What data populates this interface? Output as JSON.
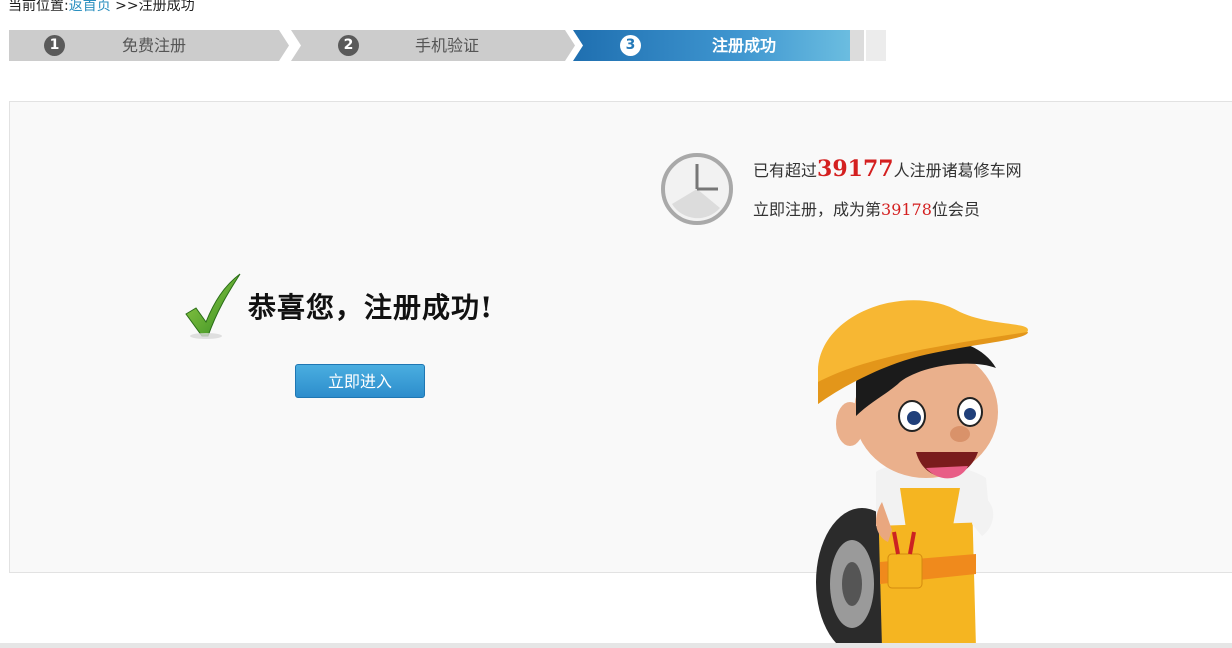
{
  "breadcrumb": {
    "prefix": "当前位置:",
    "home_link": "返首页",
    "current": ">>注册成功"
  },
  "steps": [
    {
      "num": "1",
      "label": "免费注册",
      "state": "done"
    },
    {
      "num": "2",
      "label": "手机验证",
      "state": "done"
    },
    {
      "num": "3",
      "label": "注册成功",
      "state": "active"
    }
  ],
  "success": {
    "title": "恭喜您，注册成功!",
    "enter_button": "立即进入"
  },
  "stats": {
    "line1_prefix": "已有超过",
    "user_count": "39177",
    "line1_suffix": "人注册诸葛修车网",
    "line2_prefix": "立即注册，成为第",
    "member_number": "39178",
    "line2_suffix": "位会员"
  },
  "colors": {
    "accent_blue": "#2d8dcc",
    "highlight_red": "#d42020",
    "step_inactive": "#cccccc"
  },
  "icons": [
    "check-icon",
    "clock-icon",
    "mascot-mechanic"
  ]
}
